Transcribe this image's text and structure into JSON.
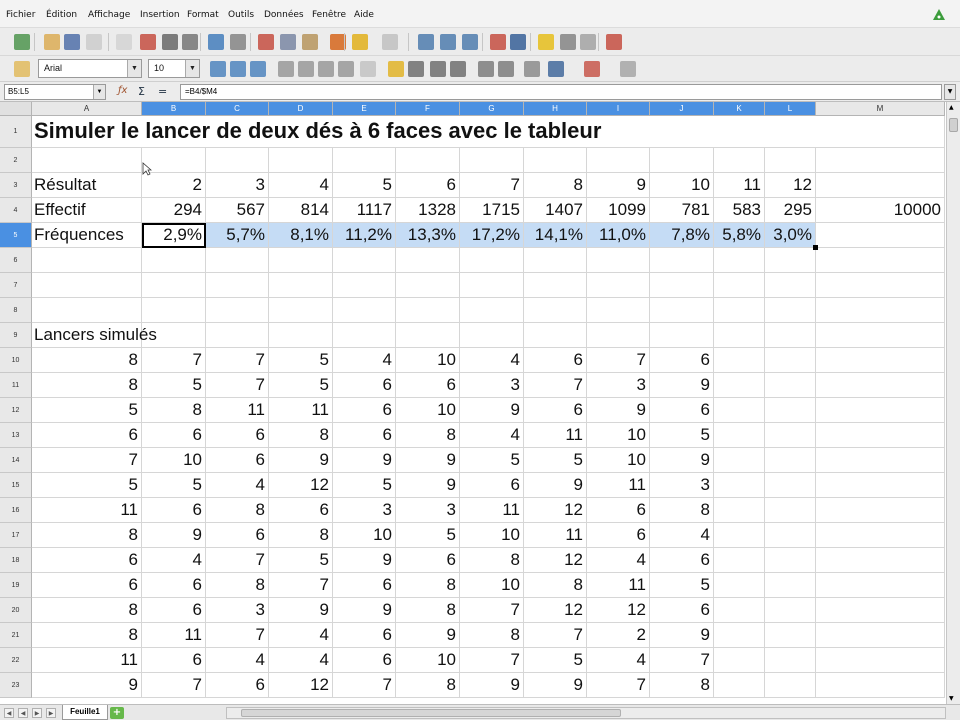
{
  "menu": [
    "Fichier",
    "Édition",
    "Affichage",
    "Insertion",
    "Format",
    "Outils",
    "Données",
    "Fenêtre",
    "Aide"
  ],
  "toolbar": {
    "font_name": "Arial",
    "font_size": "10"
  },
  "formula_bar": {
    "name_box": "B5:L5",
    "formula": "=B4/$M4",
    "sum_symbol": "Σ",
    "equals_symbol": "="
  },
  "columns": [
    "A",
    "B",
    "C",
    "D",
    "E",
    "F",
    "G",
    "H",
    "I",
    "J",
    "K",
    "L",
    "M"
  ],
  "selected_columns": [
    "B",
    "C",
    "D",
    "E",
    "F",
    "G",
    "H",
    "I",
    "J",
    "K",
    "L"
  ],
  "rows": [
    1,
    2,
    3,
    4,
    5,
    6,
    7,
    8,
    9,
    10,
    11,
    12,
    13,
    14,
    15,
    16,
    17,
    18,
    19,
    20,
    21,
    22,
    23
  ],
  "selected_row": 5,
  "sheet": {
    "title": "Simuler le lancer de deux dés à 6 faces avec le tableur",
    "resultat_label": "Résultat",
    "resultats": [
      "2",
      "3",
      "4",
      "5",
      "6",
      "7",
      "8",
      "9",
      "10",
      "11",
      "12"
    ],
    "effectif_label": "Effectif",
    "effectifs": [
      "294",
      "567",
      "814",
      "1117",
      "1328",
      "1715",
      "1407",
      "1099",
      "781",
      "583",
      "295"
    ],
    "total": "10000",
    "frequences_label": "Fréquences",
    "frequences": [
      "2,9%",
      "5,7%",
      "8,1%",
      "11,2%",
      "13,3%",
      "17,2%",
      "14,1%",
      "11,0%",
      "7,8%",
      "5,8%",
      "3,0%"
    ],
    "lancers_label": "Lancers simulés",
    "lancers": [
      [
        "8",
        "7",
        "7",
        "5",
        "4",
        "10",
        "4",
        "6",
        "7",
        "6"
      ],
      [
        "8",
        "5",
        "7",
        "5",
        "6",
        "6",
        "3",
        "7",
        "3",
        "9"
      ],
      [
        "5",
        "8",
        "11",
        "11",
        "6",
        "10",
        "9",
        "6",
        "9",
        "6"
      ],
      [
        "6",
        "6",
        "6",
        "8",
        "6",
        "8",
        "4",
        "11",
        "10",
        "5"
      ],
      [
        "7",
        "10",
        "6",
        "9",
        "9",
        "9",
        "5",
        "5",
        "10",
        "9"
      ],
      [
        "5",
        "5",
        "4",
        "12",
        "5",
        "9",
        "6",
        "9",
        "11",
        "3"
      ],
      [
        "11",
        "6",
        "8",
        "6",
        "3",
        "3",
        "11",
        "12",
        "6",
        "8"
      ],
      [
        "8",
        "9",
        "6",
        "8",
        "10",
        "5",
        "10",
        "11",
        "6",
        "4"
      ],
      [
        "6",
        "4",
        "7",
        "5",
        "9",
        "6",
        "8",
        "12",
        "4",
        "6"
      ],
      [
        "6",
        "6",
        "8",
        "7",
        "6",
        "8",
        "10",
        "8",
        "11",
        "5"
      ],
      [
        "8",
        "6",
        "3",
        "9",
        "9",
        "8",
        "7",
        "12",
        "12",
        "6"
      ],
      [
        "8",
        "11",
        "7",
        "4",
        "6",
        "9",
        "8",
        "7",
        "2",
        "9"
      ],
      [
        "11",
        "6",
        "4",
        "4",
        "6",
        "10",
        "7",
        "5",
        "4",
        "7"
      ],
      [
        "9",
        "7",
        "6",
        "12",
        "7",
        "8",
        "9",
        "9",
        "7",
        "8"
      ]
    ]
  },
  "sheet_tab": "Feuille1",
  "add_sheet_symbol": "+",
  "colors": {
    "selection": "#c5dcf5",
    "header_selected": "#4a90e2"
  }
}
